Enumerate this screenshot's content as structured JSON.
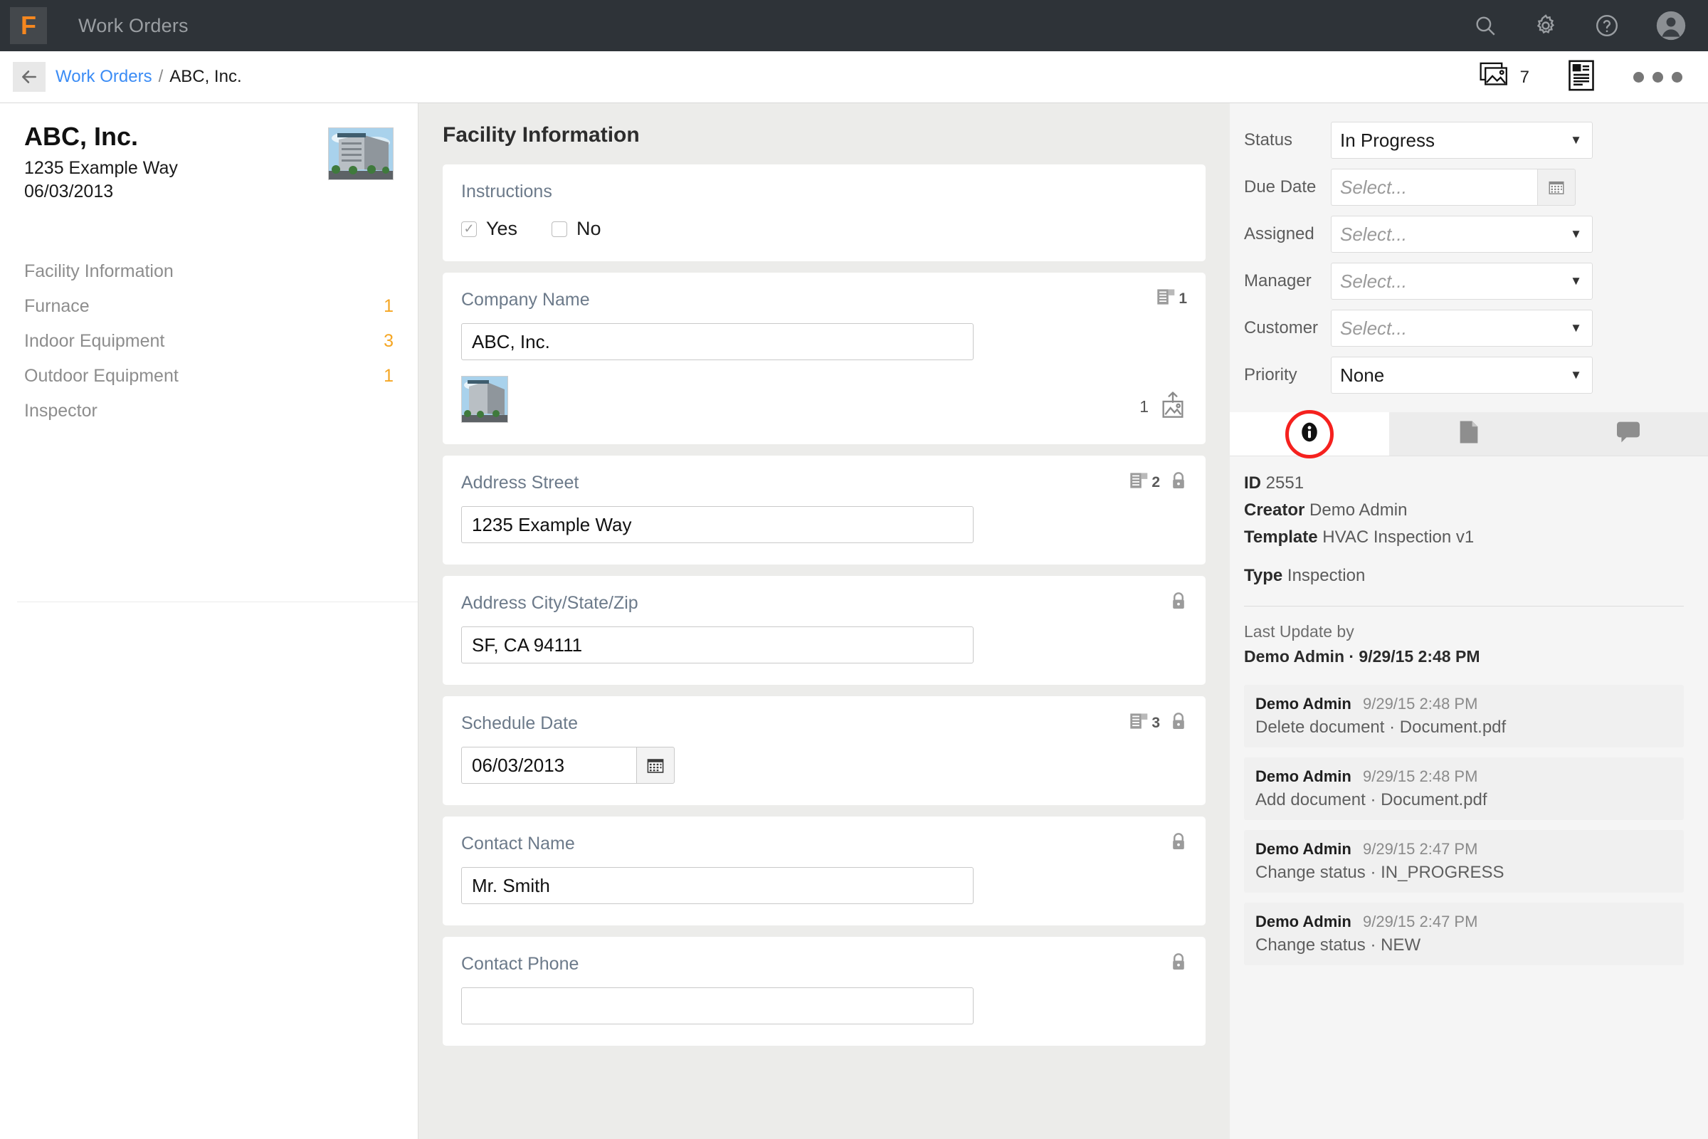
{
  "topbar": {
    "logo_letter": "F",
    "title": "Work Orders",
    "icons": [
      "search-icon",
      "gear-icon",
      "help-icon",
      "avatar-icon"
    ]
  },
  "breadcrumb": {
    "back_icon": "back-arrow-icon",
    "parent": "Work Orders",
    "separator": "/",
    "current": "ABC, Inc.",
    "gallery_count": "7",
    "gallery_icon": "gallery-icon",
    "report_icon": "report-icon",
    "more_icon": "more-dots-icon"
  },
  "sidebar": {
    "title": "ABC, Inc.",
    "address": "1235 Example Way",
    "date": "06/03/2013",
    "thumb_icon": "building-photo",
    "items": [
      {
        "label": "Facility Information",
        "count": ""
      },
      {
        "label": "Furnace",
        "count": "1"
      },
      {
        "label": "Indoor Equipment",
        "count": "3"
      },
      {
        "label": "Outdoor Equipment",
        "count": "1"
      },
      {
        "label": "Inspector",
        "count": ""
      }
    ]
  },
  "main": {
    "title": "Facility Information",
    "instructions": {
      "label": "Instructions",
      "yes_label": "Yes",
      "no_label": "No",
      "yes_checked": true,
      "no_checked": false,
      "check_glyph": "✓"
    },
    "company": {
      "label": "Company Name",
      "value": "ABC, Inc.",
      "badge_count": "1",
      "badge_icon": "instruction-doc-icon",
      "photo_icon": "building-photo",
      "upload_count": "1",
      "upload_icon": "image-upload-icon"
    },
    "address_street": {
      "label": "Address Street",
      "value": "1235 Example Way",
      "badge_count": "2",
      "badge_icon": "instruction-doc-icon",
      "lock_icon": "lock-icon"
    },
    "address_city": {
      "label": "Address City/State/Zip",
      "value": "SF, CA 94111",
      "lock_icon": "lock-icon"
    },
    "schedule_date": {
      "label": "Schedule Date",
      "value": "06/03/2013",
      "badge_count": "3",
      "badge_icon": "instruction-doc-icon",
      "lock_icon": "lock-icon",
      "calendar_icon": "calendar-icon"
    },
    "contact_name": {
      "label": "Contact Name",
      "value": "Mr. Smith",
      "lock_icon": "lock-icon"
    },
    "contact_phone": {
      "label": "Contact Phone",
      "lock_icon": "lock-icon"
    }
  },
  "right": {
    "fields": [
      {
        "label": "Status",
        "value": "In Progress",
        "placeholder": "",
        "type": "select"
      },
      {
        "label": "Due Date",
        "value": "",
        "placeholder": "Select...",
        "type": "date"
      },
      {
        "label": "Assigned",
        "value": "",
        "placeholder": "Select...",
        "type": "select"
      },
      {
        "label": "Manager",
        "value": "",
        "placeholder": "Select...",
        "type": "select"
      },
      {
        "label": "Customer",
        "value": "",
        "placeholder": "Select...",
        "type": "select"
      },
      {
        "label": "Priority",
        "value": "None",
        "placeholder": "",
        "type": "select"
      }
    ],
    "caret_glyph": "▼",
    "tabs": [
      {
        "icon": "info-icon",
        "active": true,
        "highlighted": true
      },
      {
        "icon": "document-icon",
        "active": false,
        "highlighted": false
      },
      {
        "icon": "comment-icon",
        "active": false,
        "highlighted": false
      }
    ],
    "highlight_color": "#f5211e",
    "info": {
      "id_label": "ID",
      "id_value": "2551",
      "creator_label": "Creator",
      "creator_value": "Demo Admin",
      "template_label": "Template",
      "template_value": "HVAC Inspection v1",
      "type_label": "Type",
      "type_value": "Inspection",
      "last_update_label": "Last Update by",
      "last_update_value": "Demo Admin · 9/29/15 2:48 PM"
    },
    "activity": [
      {
        "user": "Demo Admin",
        "time": "9/29/15 2:48 PM",
        "action": "Delete document · Document.pdf"
      },
      {
        "user": "Demo Admin",
        "time": "9/29/15 2:48 PM",
        "action": "Add document · Document.pdf"
      },
      {
        "user": "Demo Admin",
        "time": "9/29/15 2:47 PM",
        "action": "Change status · IN_PROGRESS"
      },
      {
        "user": "Demo Admin",
        "time": "9/29/15 2:47 PM",
        "action": "Change status · NEW"
      }
    ]
  }
}
